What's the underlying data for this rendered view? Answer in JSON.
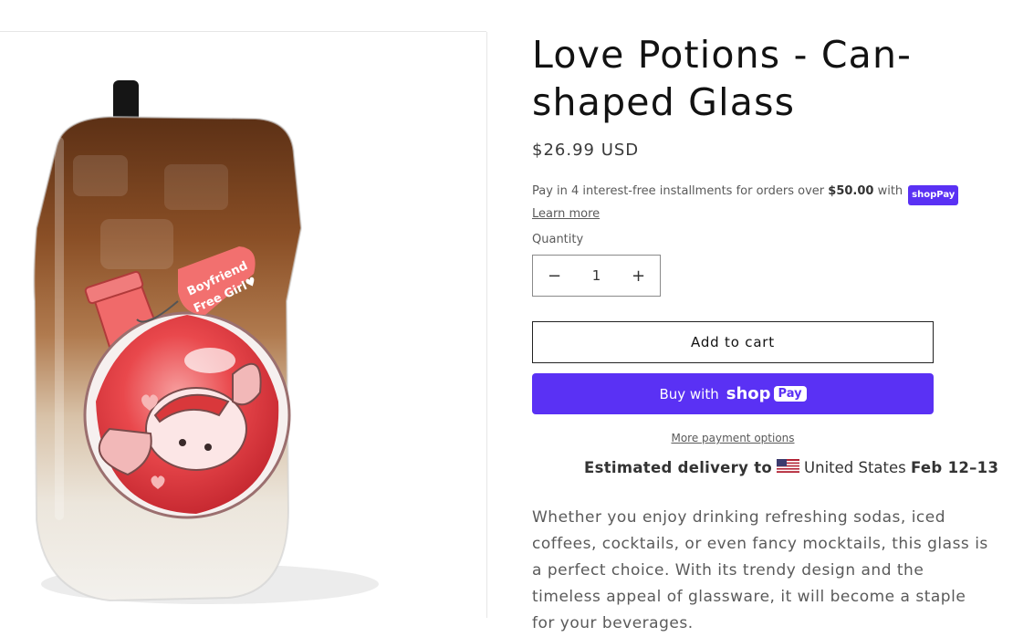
{
  "product": {
    "title": "Love Potions - Can-shaped Glass",
    "price": "$26.99 USD",
    "image_alt": "Can-shaped glass with iced coffee and a love potion bottle graphic",
    "graphic_tag_line1": "Boyfriend",
    "graphic_tag_line2": "Free Girl♥"
  },
  "installments": {
    "text_before": "Pay in 4 interest-free installments for orders over ",
    "threshold": "$50.00",
    "text_after": " with",
    "brand": "shopPay",
    "learn_more": "Learn more"
  },
  "quantity": {
    "label": "Quantity",
    "value": "1",
    "decrease_symbol": "−",
    "increase_symbol": "+"
  },
  "buttons": {
    "add_to_cart": "Add to cart",
    "buy_with_prefix": "Buy with",
    "buy_with_shop": "shop",
    "buy_with_pay": "Pay",
    "more_payment_options": "More payment options"
  },
  "delivery": {
    "prefix": "Estimated delivery to",
    "country": "United States",
    "dates": "Feb 12–13"
  },
  "description": "Whether you enjoy drinking refreshing sodas, iced coffees, cocktails, or even fancy mocktails, this glass is a perfect choice. With its trendy design and the timeless appeal of glassware, it will become a staple for your beverages.",
  "colors": {
    "shop_pay_purple": "#5a31f4",
    "text_dark": "#121212",
    "text_muted": "#5a5a5a"
  }
}
